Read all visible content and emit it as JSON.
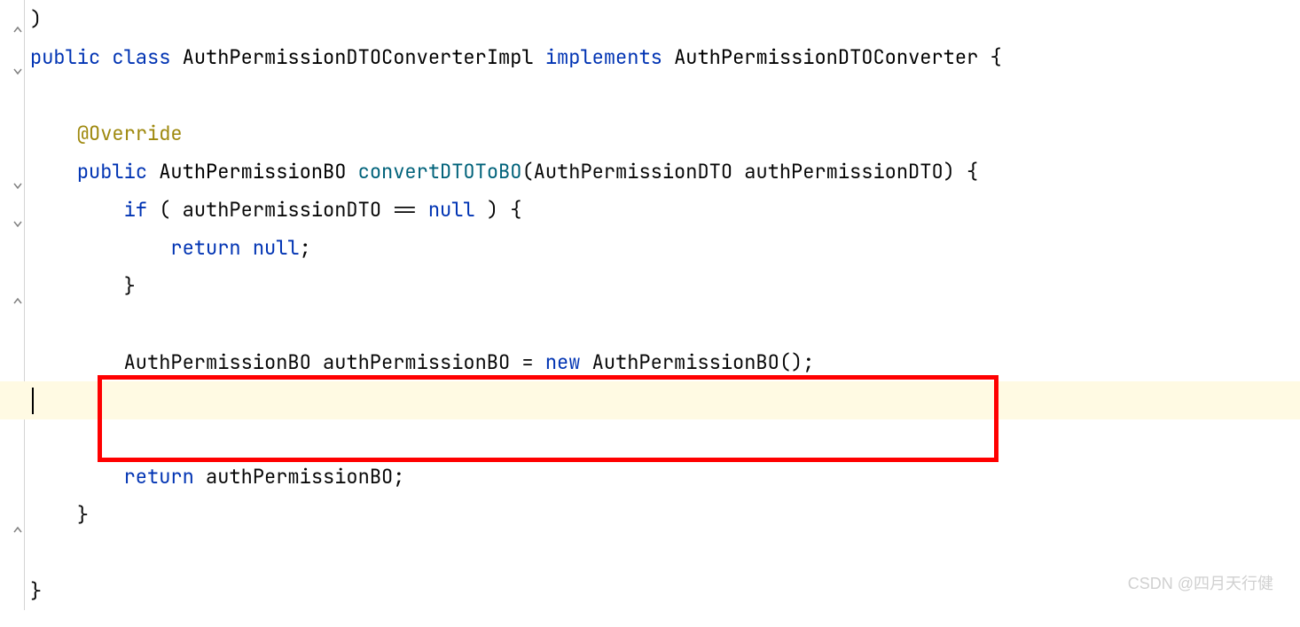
{
  "code": {
    "line1": ")",
    "line2_public": "public",
    "line2_class": "class",
    "line2_type1": "AuthPermissionDTOConverterImpl",
    "line2_implements": "implements",
    "line2_type2": "AuthPermissionDTOConverter",
    "line2_brace": " {",
    "line3": "",
    "line4_annotation": "@Override",
    "line5_public": "public",
    "line5_type": "AuthPermissionBO",
    "line5_method": "convertDTOToBO",
    "line5_params": "(AuthPermissionDTO authPermissionDTO) {",
    "line6_if": "if",
    "line6_cond": " ( authPermissionDTO == ",
    "line6_null": "null",
    "line6_end": " ) {",
    "line7_return": "return",
    "line7_null": "null",
    "line7_semi": ";",
    "line8": "}",
    "line9": "",
    "line10_type": "AuthPermissionBO authPermissionBO = ",
    "line10_new": "new",
    "line10_ctor": " AuthPermissionBO();",
    "line11": "",
    "line12": "",
    "line13_return": "return",
    "line13_val": " authPermissionBO;",
    "line14": "}",
    "line15": "",
    "line16": "}"
  },
  "watermark": "CSDN @四月天行健",
  "indent1": "    ",
  "indent2": "        ",
  "indent3": "            ",
  "space": " "
}
